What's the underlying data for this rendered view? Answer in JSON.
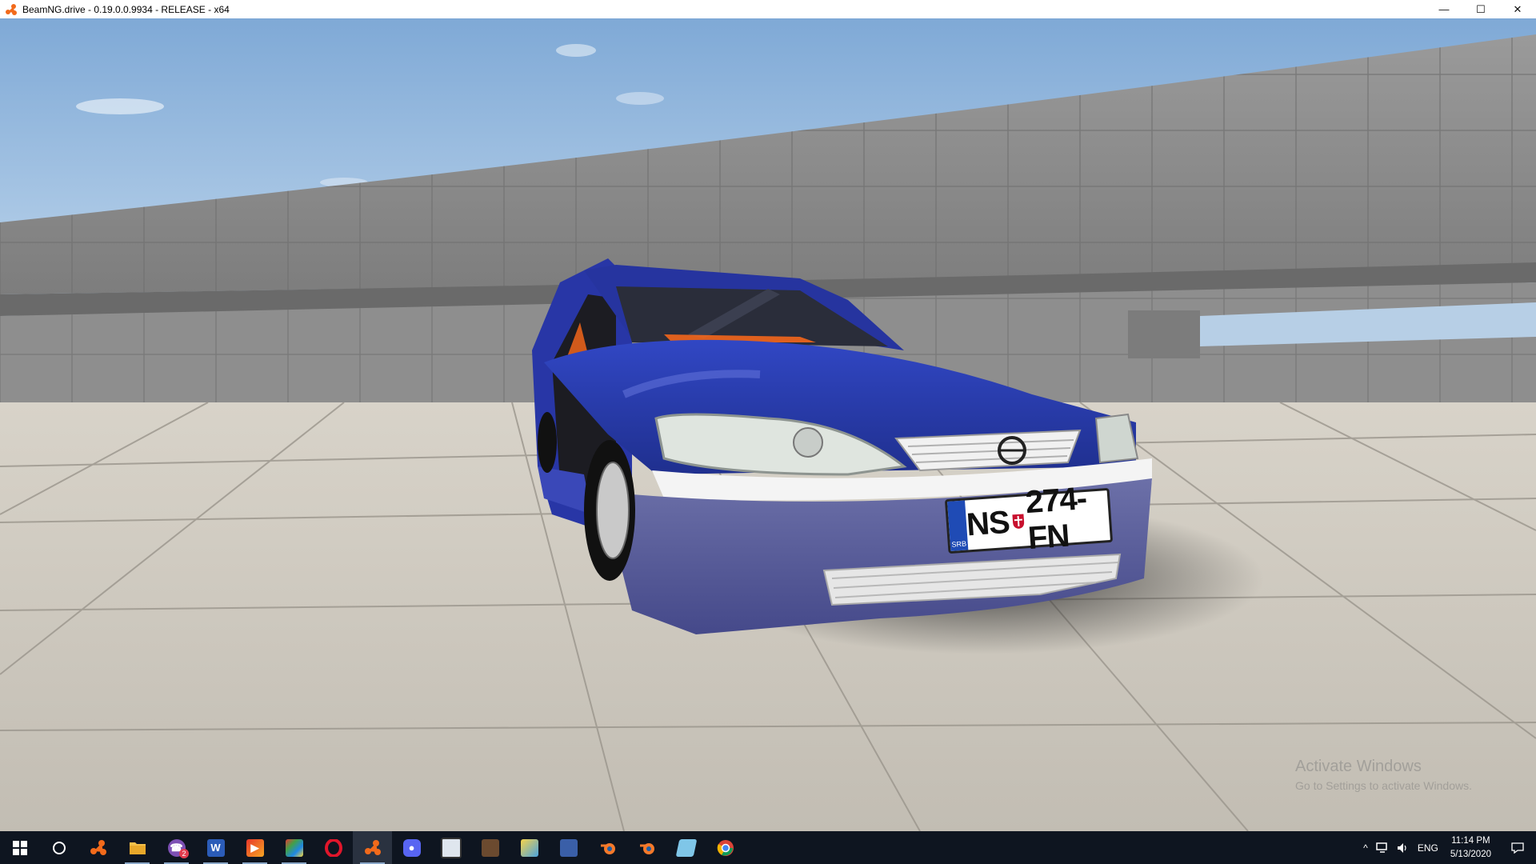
{
  "window": {
    "title": "BeamNG.drive - 0.19.0.0.9934 - RELEASE - x64",
    "icon": "beamng-logo-icon",
    "controls": [
      {
        "name": "minimize-button",
        "glyph": "—"
      },
      {
        "name": "maximize-button",
        "glyph": "☐"
      },
      {
        "name": "close-button",
        "glyph": "✕"
      }
    ]
  },
  "scene": {
    "license_plate": {
      "country": "SRB",
      "text_left": "NS",
      "text_right": "274-FN",
      "emblem_text": "NS"
    },
    "watermark": {
      "line1": "Activate Windows",
      "line2": "Go to Settings to activate Windows."
    },
    "colors": {
      "sky": "#8fb8df",
      "car_body": "#2b3fb0",
      "floor": "#c9c4ba",
      "wall": "#8b8b8b"
    }
  },
  "taskbar": {
    "apps": [
      {
        "name": "start-button",
        "icon": "windows-logo-icon"
      },
      {
        "name": "cortana-button",
        "icon": "cortana-circle-icon"
      },
      {
        "name": "app-beamng-launcher",
        "icon": "beamng-logo-icon"
      },
      {
        "name": "app-file-explorer",
        "icon": "folder-icon"
      },
      {
        "name": "app-viber",
        "icon": "viber-icon",
        "badge": "2"
      },
      {
        "name": "app-word",
        "icon": "word-icon",
        "label": "W"
      },
      {
        "name": "app-media",
        "icon": "media-app-icon"
      },
      {
        "name": "app-colorful",
        "icon": "colorful-app-icon"
      },
      {
        "name": "app-opera",
        "icon": "opera-icon",
        "label": "O"
      },
      {
        "name": "app-beamng",
        "icon": "beamng-logo-icon"
      },
      {
        "name": "app-discord",
        "icon": "discord-icon"
      },
      {
        "name": "app-window",
        "icon": "window-app-icon"
      },
      {
        "name": "app-game",
        "icon": "game-app-icon"
      },
      {
        "name": "app-photos",
        "icon": "photos-icon"
      },
      {
        "name": "app-tool",
        "icon": "tool-app-icon"
      },
      {
        "name": "app-blender-1",
        "icon": "blender-icon"
      },
      {
        "name": "app-blender-2",
        "icon": "blender-icon"
      },
      {
        "name": "app-notepad",
        "icon": "notepad-icon"
      },
      {
        "name": "app-chrome",
        "icon": "chrome-icon"
      }
    ],
    "tray": {
      "chevron": "^",
      "language": "ENG",
      "time": "11:14 PM",
      "date": "5/13/2020"
    }
  }
}
